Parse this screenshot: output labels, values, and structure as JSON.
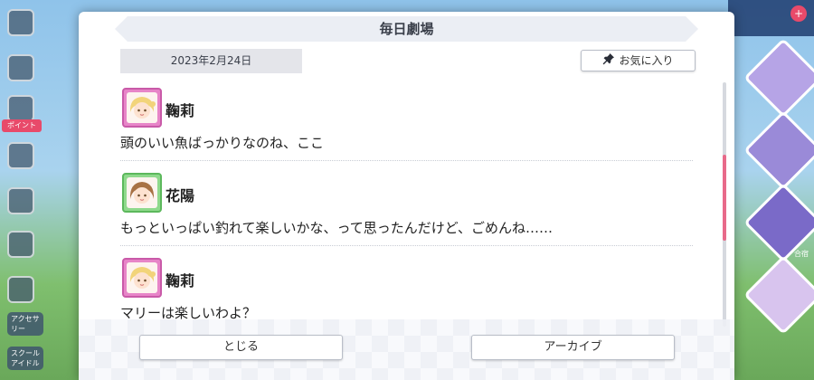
{
  "modal": {
    "title": "毎日劇場",
    "date": "2023年2月24日",
    "favorite_label": "お気に入り",
    "favorite_icon": "pin-icon",
    "close_label": "とじる",
    "archive_label": "アーカイブ"
  },
  "dialog": [
    {
      "speaker": "鞠莉",
      "text": "頭のいい魚ばっかりなのね、ここ",
      "avatar_color": "#e785c8"
    },
    {
      "speaker": "花陽",
      "text": "もっといっぱい釣れて楽しいかな、って思ったんだけど、ごめんね……",
      "avatar_color": "#8fd98c"
    },
    {
      "speaker": "鞠莉",
      "text": "マリーは楽しいわよ？",
      "avatar_color": "#e785c8"
    }
  ],
  "background": {
    "sidebar_badge": "ポイント",
    "sidebar_label_1": "アクセサリー",
    "sidebar_label_2": "スクール アイドル",
    "right_label": "合宿",
    "accent": "#e84a6a"
  }
}
